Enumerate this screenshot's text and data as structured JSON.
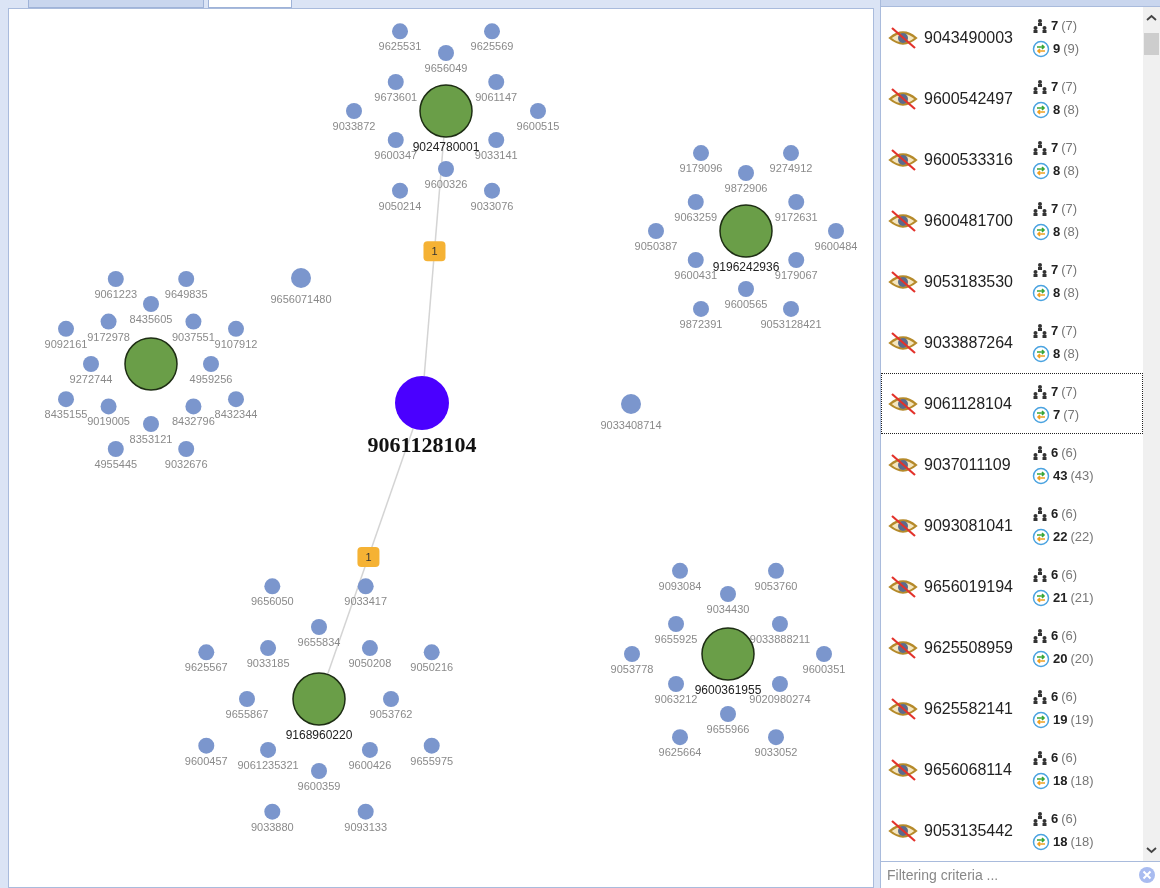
{
  "tabs": [
    {
      "selected": false
    },
    {
      "selected": true
    }
  ],
  "graph": {
    "center": {
      "label": "9061128104"
    },
    "links": [
      {
        "weight": "1"
      },
      {
        "weight": "1"
      }
    ],
    "standalone": [
      {
        "label": "9656071480"
      },
      {
        "label": "9033408714"
      }
    ],
    "clusters": [
      {
        "hub_label": "9024780001",
        "labels": [
          "9625531",
          "9625569",
          "9656049",
          "9673601",
          "9061147",
          "9033872",
          "9600515",
          "9600347",
          "9033141",
          "9600326",
          "9050214",
          "9033076"
        ]
      },
      {
        "hub_label": "9196242936",
        "labels": [
          "9179096",
          "9274912",
          "9872906",
          "9063259",
          "9172631",
          "9050387",
          "9600484",
          "9600431",
          "9179067",
          "9600565",
          "9872391",
          "9053128421"
        ]
      },
      {
        "labels": [
          "9061223",
          "9649835",
          "8435605",
          "9092161",
          "9172978",
          "9037551",
          "9107912",
          "9272744",
          "4959256",
          "8435155",
          "9019005",
          "8432796",
          "8432344",
          "8353121",
          "4955445",
          "9032676"
        ]
      },
      {
        "hub_label": "9168960220",
        "labels": [
          "9656050",
          "9033417",
          "9655834",
          "9625567",
          "9033185",
          "9050208",
          "9050216",
          "9655867",
          "9053762",
          "9600457",
          "9061235321",
          "9600426",
          "9655975",
          "9600359",
          "9033880",
          "9093133"
        ]
      },
      {
        "hub_label": "9600361955",
        "labels": [
          "9093084",
          "9053760",
          "9034430",
          "9655925",
          "9033888211",
          "9053778",
          "9600351",
          "9063212",
          "9020980274",
          "9655966",
          "9625664",
          "9033052"
        ]
      }
    ]
  },
  "list": {
    "rows": [
      {
        "number": "9043490003",
        "links": "7",
        "links_total": "(7)",
        "calls": "9",
        "calls_total": "(9)",
        "selected": false
      },
      {
        "number": "9600542497",
        "links": "7",
        "links_total": "(7)",
        "calls": "8",
        "calls_total": "(8)",
        "selected": false
      },
      {
        "number": "9600533316",
        "links": "7",
        "links_total": "(7)",
        "calls": "8",
        "calls_total": "(8)",
        "selected": false
      },
      {
        "number": "9600481700",
        "links": "7",
        "links_total": "(7)",
        "calls": "8",
        "calls_total": "(8)",
        "selected": false
      },
      {
        "number": "9053183530",
        "links": "7",
        "links_total": "(7)",
        "calls": "8",
        "calls_total": "(8)",
        "selected": false
      },
      {
        "number": "9033887264",
        "links": "7",
        "links_total": "(7)",
        "calls": "8",
        "calls_total": "(8)",
        "selected": false
      },
      {
        "number": "9061128104",
        "links": "7",
        "links_total": "(7)",
        "calls": "7",
        "calls_total": "(7)",
        "selected": true
      },
      {
        "number": "9037011109",
        "links": "6",
        "links_total": "(6)",
        "calls": "43",
        "calls_total": "(43)",
        "selected": false
      },
      {
        "number": "9093081041",
        "links": "6",
        "links_total": "(6)",
        "calls": "22",
        "calls_total": "(22)",
        "selected": false
      },
      {
        "number": "9656019194",
        "links": "6",
        "links_total": "(6)",
        "calls": "21",
        "calls_total": "(21)",
        "selected": false
      },
      {
        "number": "9625508959",
        "links": "6",
        "links_total": "(6)",
        "calls": "20",
        "calls_total": "(20)",
        "selected": false
      },
      {
        "number": "9625582141",
        "links": "6",
        "links_total": "(6)",
        "calls": "19",
        "calls_total": "(19)",
        "selected": false
      },
      {
        "number": "9656068114",
        "links": "6",
        "links_total": "(6)",
        "calls": "18",
        "calls_total": "(18)",
        "selected": false
      },
      {
        "number": "9053135442",
        "links": "6",
        "links_total": "(6)",
        "calls": "18",
        "calls_total": "(18)",
        "selected": false
      }
    ],
    "filter": {
      "placeholder": "Filtering criteria ..."
    }
  }
}
